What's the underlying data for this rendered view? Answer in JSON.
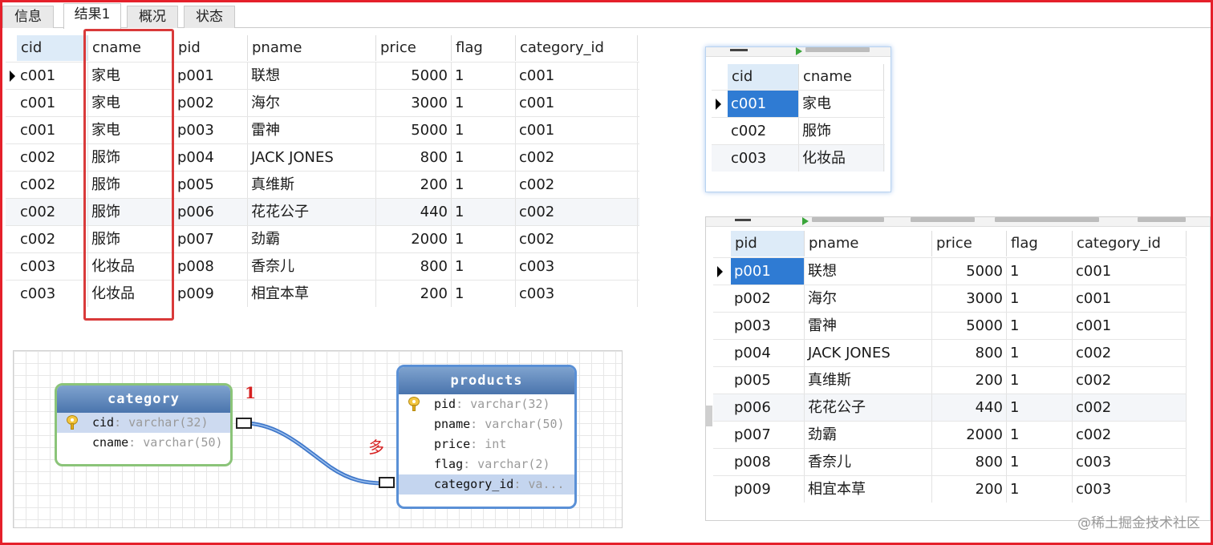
{
  "tabs": [
    "信息",
    "结果1",
    "概况",
    "状态"
  ],
  "active_tab": "结果1",
  "result": {
    "columns": [
      "cid",
      "cname",
      "pid",
      "pname",
      "price",
      "flag",
      "category_id"
    ],
    "rows": [
      [
        "c001",
        "家电",
        "p001",
        "联想",
        "5000",
        "1",
        "c001"
      ],
      [
        "c001",
        "家电",
        "p002",
        "海尔",
        "3000",
        "1",
        "c001"
      ],
      [
        "c001",
        "家电",
        "p003",
        "雷神",
        "5000",
        "1",
        "c001"
      ],
      [
        "c002",
        "服饰",
        "p004",
        "JACK JONES",
        "800",
        "1",
        "c002"
      ],
      [
        "c002",
        "服饰",
        "p005",
        "真维斯",
        "200",
        "1",
        "c002"
      ],
      [
        "c002",
        "服饰",
        "p006",
        "花花公子",
        "440",
        "1",
        "c002"
      ],
      [
        "c002",
        "服饰",
        "p007",
        "劲霸",
        "2000",
        "1",
        "c002"
      ],
      [
        "c003",
        "化妆品",
        "p008",
        "香奈儿",
        "800",
        "1",
        "c003"
      ],
      [
        "c003",
        "化妆品",
        "p009",
        "相宜本草",
        "200",
        "1",
        "c003"
      ]
    ]
  },
  "category_table": {
    "columns": [
      "cid",
      "cname"
    ],
    "rows": [
      [
        "c001",
        "家电"
      ],
      [
        "c002",
        "服饰"
      ],
      [
        "c003",
        "化妆品"
      ]
    ]
  },
  "products_table": {
    "columns": [
      "pid",
      "pname",
      "price",
      "flag",
      "category_id"
    ],
    "rows": [
      [
        "p001",
        "联想",
        "5000",
        "1",
        "c001"
      ],
      [
        "p002",
        "海尔",
        "3000",
        "1",
        "c001"
      ],
      [
        "p003",
        "雷神",
        "5000",
        "1",
        "c001"
      ],
      [
        "p004",
        "JACK JONES",
        "800",
        "1",
        "c002"
      ],
      [
        "p005",
        "真维斯",
        "200",
        "1",
        "c002"
      ],
      [
        "p006",
        "花花公子",
        "440",
        "1",
        "c002"
      ],
      [
        "p007",
        "劲霸",
        "2000",
        "1",
        "c002"
      ],
      [
        "p008",
        "香奈儿",
        "800",
        "1",
        "c003"
      ],
      [
        "p009",
        "相宜本草",
        "200",
        "1",
        "c003"
      ]
    ]
  },
  "er": {
    "category": {
      "title": "category",
      "fields": [
        {
          "name": "cid",
          "type": ": varchar(32)"
        },
        {
          "name": "cname",
          "type": ": varchar(50)"
        }
      ]
    },
    "products": {
      "title": "products",
      "fields": [
        {
          "name": "pid",
          "type": ": varchar(32)"
        },
        {
          "name": "pname",
          "type": ": varchar(50)"
        },
        {
          "name": "price",
          "type": ": int"
        },
        {
          "name": "flag",
          "type": ": varchar(2)"
        },
        {
          "name": "category_id",
          "type": ": va..."
        }
      ]
    },
    "card_one": "1",
    "card_many": "多"
  },
  "watermark": "@稀土掘金技术社区",
  "colors": {
    "frame": "#e5202a",
    "highlight": "#d93a3a",
    "selection": "#2f7bd3",
    "relation_line": "#3f77c9"
  }
}
